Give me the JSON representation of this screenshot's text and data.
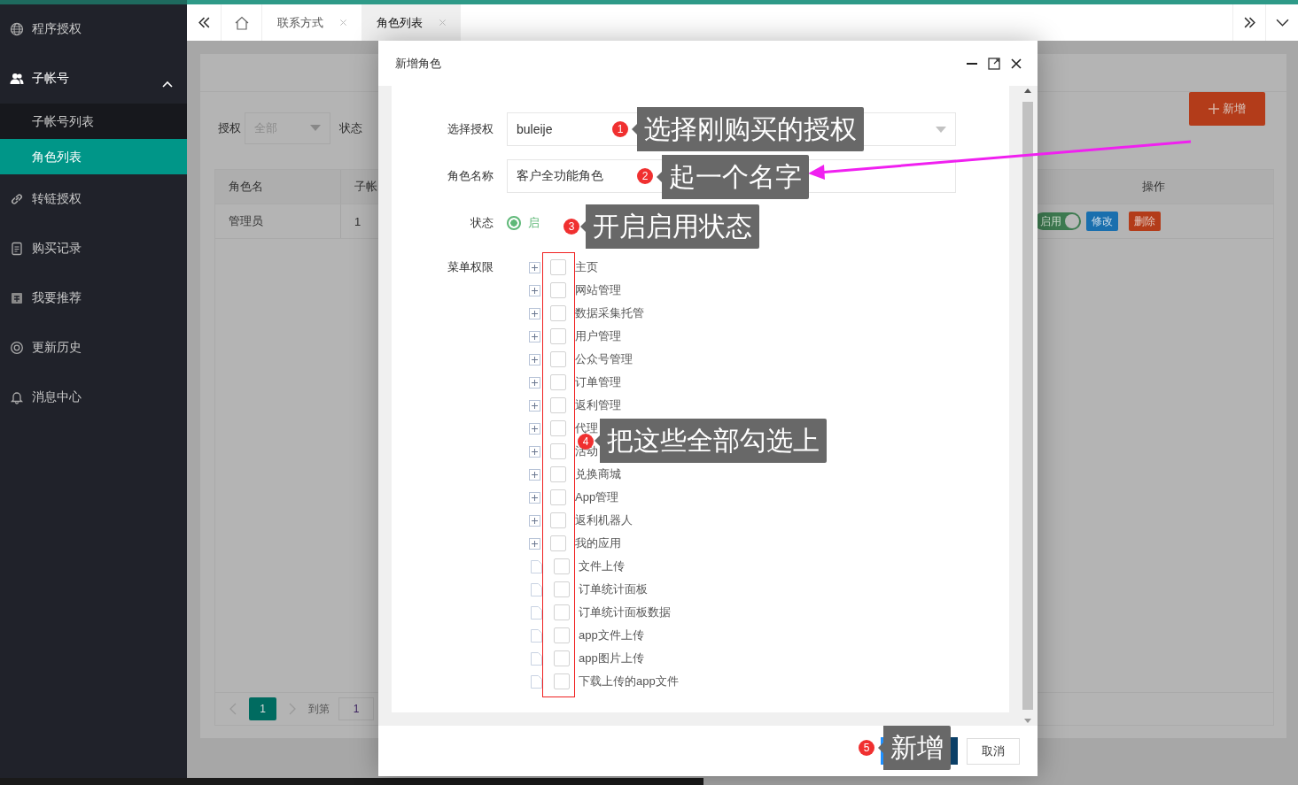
{
  "sidebar": {
    "items": [
      {
        "kind": "link",
        "label": "程序授权",
        "selected": false
      },
      {
        "kind": "group",
        "label": "子帐号",
        "expanded": true,
        "selected": false,
        "children": [
          {
            "label": "子帐号列表",
            "selected": false
          },
          {
            "label": "角色列表",
            "selected": true
          }
        ]
      },
      {
        "kind": "link",
        "label": "转链授权",
        "selected": false
      },
      {
        "kind": "link",
        "label": "购买记录",
        "selected": false
      },
      {
        "kind": "link",
        "label": "我要推荐",
        "selected": false
      },
      {
        "kind": "link",
        "label": "更新历史",
        "selected": false
      },
      {
        "kind": "link",
        "label": "消息中心",
        "selected": false
      }
    ]
  },
  "tabs": [
    {
      "label": "联系方式",
      "selected": false
    },
    {
      "label": "角色列表",
      "selected": true
    }
  ],
  "filter": {
    "auth_label": "授权",
    "auth_value": "全部",
    "status_label": "状态",
    "add_button": "新增"
  },
  "table": {
    "columns": [
      "角色名",
      "子帐",
      "操作"
    ],
    "rows": [
      {
        "cells": [
          "管理员",
          "1"
        ],
        "enabled": true,
        "toggle_label": "启用",
        "edit": "修改",
        "delete": "删除"
      }
    ]
  },
  "pagination": {
    "pages": [
      {
        "label": "1",
        "selected": true
      }
    ],
    "goto_label": "到第",
    "goto_value": "1"
  },
  "dialog": {
    "title": "新增角色",
    "auth": {
      "label": "选择授权",
      "value": "buleije"
    },
    "name": {
      "label": "角色名称",
      "value": "客户全功能角色"
    },
    "status": {
      "label": "状态",
      "options": [
        {
          "label": "启",
          "selected": true
        }
      ]
    },
    "menu": {
      "label": "菜单权限",
      "items": [
        {
          "kind": "folder",
          "label": "主页",
          "checked": false
        },
        {
          "kind": "folder",
          "label": "网站管理",
          "checked": false
        },
        {
          "kind": "folder",
          "label": "数据采集托管",
          "checked": false
        },
        {
          "kind": "folder",
          "label": "用户管理",
          "checked": false
        },
        {
          "kind": "folder",
          "label": "公众号管理",
          "checked": false
        },
        {
          "kind": "folder",
          "label": "订单管理",
          "checked": false
        },
        {
          "kind": "folder",
          "label": "返利管理",
          "checked": false
        },
        {
          "kind": "folder",
          "label": "代理",
          "checked": false
        },
        {
          "kind": "folder",
          "label": "活动",
          "checked": false
        },
        {
          "kind": "folder",
          "label": "兑换商城",
          "checked": false
        },
        {
          "kind": "folder",
          "label": "App管理",
          "checked": false
        },
        {
          "kind": "folder",
          "label": "返利机器人",
          "checked": false
        },
        {
          "kind": "folder",
          "label": "我的应用",
          "checked": false
        },
        {
          "kind": "leaf",
          "label": "文件上传",
          "checked": false
        },
        {
          "kind": "leaf",
          "label": "订单统计面板",
          "checked": false
        },
        {
          "kind": "leaf",
          "label": "订单统计面板数据",
          "checked": false
        },
        {
          "kind": "leaf",
          "label": "app文件上传",
          "checked": false
        },
        {
          "kind": "leaf",
          "label": "app图片上传",
          "checked": false
        },
        {
          "kind": "leaf",
          "label": "下载上传的app文件",
          "checked": false
        }
      ]
    },
    "cancel_button": "取消"
  },
  "annotations": [
    {
      "number": "1",
      "text": "选择刚购买的授权"
    },
    {
      "number": "2",
      "text": "起一个名字"
    },
    {
      "number": "3",
      "text": "开启启用状态"
    },
    {
      "number": "4",
      "text": "把这些全部勾选上"
    },
    {
      "number": "5",
      "text": "新增"
    }
  ]
}
